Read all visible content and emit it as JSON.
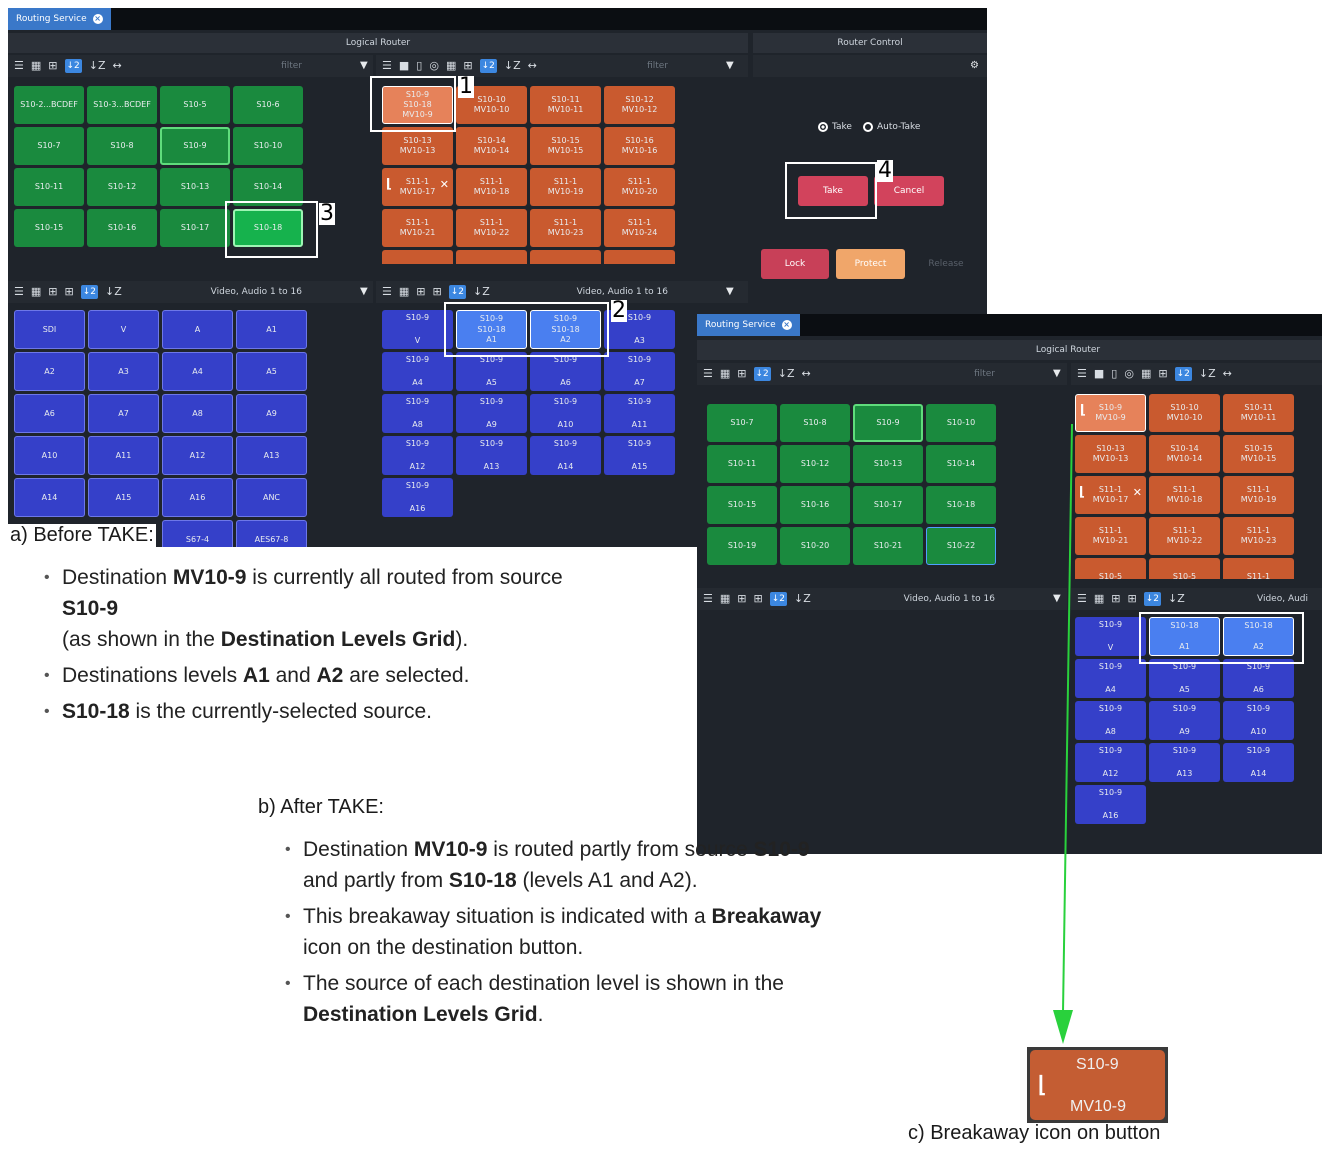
{
  "app": {
    "tab_label": "Routing Service"
  },
  "screen_a": {
    "logical_router": "Logical Router",
    "router_control": "Router Control",
    "filter": "filter",
    "level_filter": "Video, Audio 1 to 16",
    "sources": [
      "S10-2...BCDEF",
      "S10-3...BCDEF",
      "S10-5",
      "S10-6",
      "S10-7",
      "S10-8",
      "S10-9",
      "S10-10",
      "S10-11",
      "S10-12",
      "S10-13",
      "S10-14",
      "S10-15",
      "S10-16",
      "S10-17",
      "S10-18"
    ],
    "destinations": [
      {
        "src": "S10-9\nS10-18",
        "dst": "MV10-9"
      },
      {
        "src": "S10-10",
        "dst": "MV10-10"
      },
      {
        "src": "S10-11",
        "dst": "MV10-11"
      },
      {
        "src": "S10-12",
        "dst": "MV10-12"
      },
      {
        "src": "S10-13",
        "dst": "MV10-13"
      },
      {
        "src": "S10-14",
        "dst": "MV10-14"
      },
      {
        "src": "S10-15",
        "dst": "MV10-15"
      },
      {
        "src": "S10-16",
        "dst": "MV10-16"
      },
      {
        "src": "S11-1",
        "dst": "MV10-17"
      },
      {
        "src": "S11-1",
        "dst": "MV10-18"
      },
      {
        "src": "S11-1",
        "dst": "MV10-19"
      },
      {
        "src": "S11-1",
        "dst": "MV10-20"
      },
      {
        "src": "S11-1",
        "dst": "MV10-21"
      },
      {
        "src": "S11-1",
        "dst": "MV10-22"
      },
      {
        "src": "S11-1",
        "dst": "MV10-23"
      },
      {
        "src": "S11-1",
        "dst": "MV10-24"
      },
      {
        "src": "S10-5",
        "dst": ""
      },
      {
        "src": "S10-5",
        "dst": ""
      },
      {
        "src": "S11-1",
        "dst": ""
      },
      {
        "src": "S11-1",
        "dst": ""
      }
    ],
    "source_levels": [
      "SDI",
      "V",
      "A",
      "A1",
      "A2",
      "A3",
      "A4",
      "A5",
      "A6",
      "A7",
      "A8",
      "A9",
      "A10",
      "A11",
      "A12",
      "A13",
      "A14",
      "A15",
      "A16",
      "ANC",
      "",
      "",
      "S67-4",
      "AES67-8"
    ],
    "dest_levels": [
      {
        "src": "S10-9",
        "lvl": "V"
      },
      {
        "src": "S10-9\nS10-18",
        "lvl": "A1"
      },
      {
        "src": "S10-9\nS10-18",
        "lvl": "A2"
      },
      {
        "src": "S10-9",
        "lvl": "A3"
      },
      {
        "src": "S10-9",
        "lvl": "A4"
      },
      {
        "src": "S10-9",
        "lvl": "A5"
      },
      {
        "src": "S10-9",
        "lvl": "A6"
      },
      {
        "src": "S10-9",
        "lvl": "A7"
      },
      {
        "src": "S10-9",
        "lvl": "A8"
      },
      {
        "src": "S10-9",
        "lvl": "A9"
      },
      {
        "src": "S10-9",
        "lvl": "A10"
      },
      {
        "src": "S10-9",
        "lvl": "A11"
      },
      {
        "src": "S10-9",
        "lvl": "A12"
      },
      {
        "src": "S10-9",
        "lvl": "A13"
      },
      {
        "src": "S10-9",
        "lvl": "A14"
      },
      {
        "src": "S10-9",
        "lvl": "A15"
      },
      {
        "src": "S10-9",
        "lvl": "A16"
      }
    ],
    "control": {
      "take_radio": "Take",
      "auto_take_radio": "Auto-Take",
      "take": "Take",
      "cancel": "Cancel",
      "lock": "Lock",
      "protect": "Protect",
      "release": "Release"
    },
    "callouts": [
      "1",
      "2",
      "3",
      "4"
    ]
  },
  "screen_b": {
    "sources": [
      "S10-7",
      "S10-8",
      "S10-9",
      "S10-10",
      "S10-11",
      "S10-12",
      "S10-13",
      "S10-14",
      "S10-15",
      "S10-16",
      "S10-17",
      "S10-18",
      "S10-19",
      "S10-20",
      "S10-21",
      "S10-22"
    ],
    "destinations": [
      {
        "src": "S10-9",
        "dst": "MV10-9"
      },
      {
        "src": "S10-10",
        "dst": "MV10-10"
      },
      {
        "src": "S10-11",
        "dst": "MV10-11"
      },
      {
        "src": "S10-13",
        "dst": "MV10-13"
      },
      {
        "src": "S10-14",
        "dst": "MV10-14"
      },
      {
        "src": "S10-15",
        "dst": "MV10-15"
      },
      {
        "src": "S11-1",
        "dst": "MV10-17"
      },
      {
        "src": "S11-1",
        "dst": "MV10-18"
      },
      {
        "src": "S11-1",
        "dst": "MV10-19"
      },
      {
        "src": "S11-1",
        "dst": "MV10-21"
      },
      {
        "src": "S11-1",
        "dst": "MV10-22"
      },
      {
        "src": "S11-1",
        "dst": "MV10-23"
      },
      {
        "src": "S10-5",
        "dst": ""
      },
      {
        "src": "S10-5",
        "dst": ""
      },
      {
        "src": "S11-1",
        "dst": ""
      }
    ],
    "dest_levels": [
      {
        "src": "S10-9",
        "lvl": "V"
      },
      {
        "src": "S10-18",
        "lvl": "A1"
      },
      {
        "src": "S10-18",
        "lvl": "A2"
      },
      {
        "src": "S10-9",
        "lvl": "A4"
      },
      {
        "src": "S10-9",
        "lvl": "A5"
      },
      {
        "src": "S10-9",
        "lvl": "A6"
      },
      {
        "src": "S10-9",
        "lvl": "A8"
      },
      {
        "src": "S10-9",
        "lvl": "A9"
      },
      {
        "src": "S10-9",
        "lvl": "A10"
      },
      {
        "src": "S10-9",
        "lvl": "A12"
      },
      {
        "src": "S10-9",
        "lvl": "A13"
      },
      {
        "src": "S10-9",
        "lvl": "A14"
      },
      {
        "src": "S10-9",
        "lvl": "A16"
      }
    ],
    "level_filter": "Video, Audi"
  },
  "zoom": {
    "src": "S10-9",
    "dst": "MV10-9"
  },
  "text": {
    "caption_a": "a) Before TAKE:",
    "a_b1_pre": "Destination ",
    "a_b1_bold": "MV10-9",
    "a_b1_mid": " is currently all routed from source ",
    "a_b1_bold2": "S10-9",
    "a_b1_line2_pre": "(as shown in the ",
    "a_b1_line2_bold": "Destination Levels Grid",
    "a_b1_line2_post": ").",
    "a_b2_pre": "Destinations levels ",
    "a_b2_bold1": "A1",
    "a_b2_mid": " and ",
    "a_b2_bold2": "A2",
    "a_b2_post": " are selected.",
    "a_b3_bold": "S10-18",
    "a_b3_post": " is the currently-selected source.",
    "caption_b": "b) After TAKE:",
    "b_b1_pre": "Destination ",
    "b_b1_bold": "MV10-9",
    "b_b1_mid": " is routed partly from source ",
    "b_b1_bold2": "S10-9",
    "b_b1_l2_pre": "and partly from ",
    "b_b1_l2_bold": "S10-18",
    "b_b1_l2_post": " (levels A1 and A2).",
    "b_b2_pre": "This breakaway situation is indicated with a ",
    "b_b2_bold": "Breakaway",
    "b_b2_l2": "icon on the destination button.",
    "b_b3_pre": "The source of each destination level is shown in the",
    "b_b3_bold": "Destination Levels Grid",
    "b_b3_post": ".",
    "caption_c": "c) Breakaway icon on button"
  }
}
